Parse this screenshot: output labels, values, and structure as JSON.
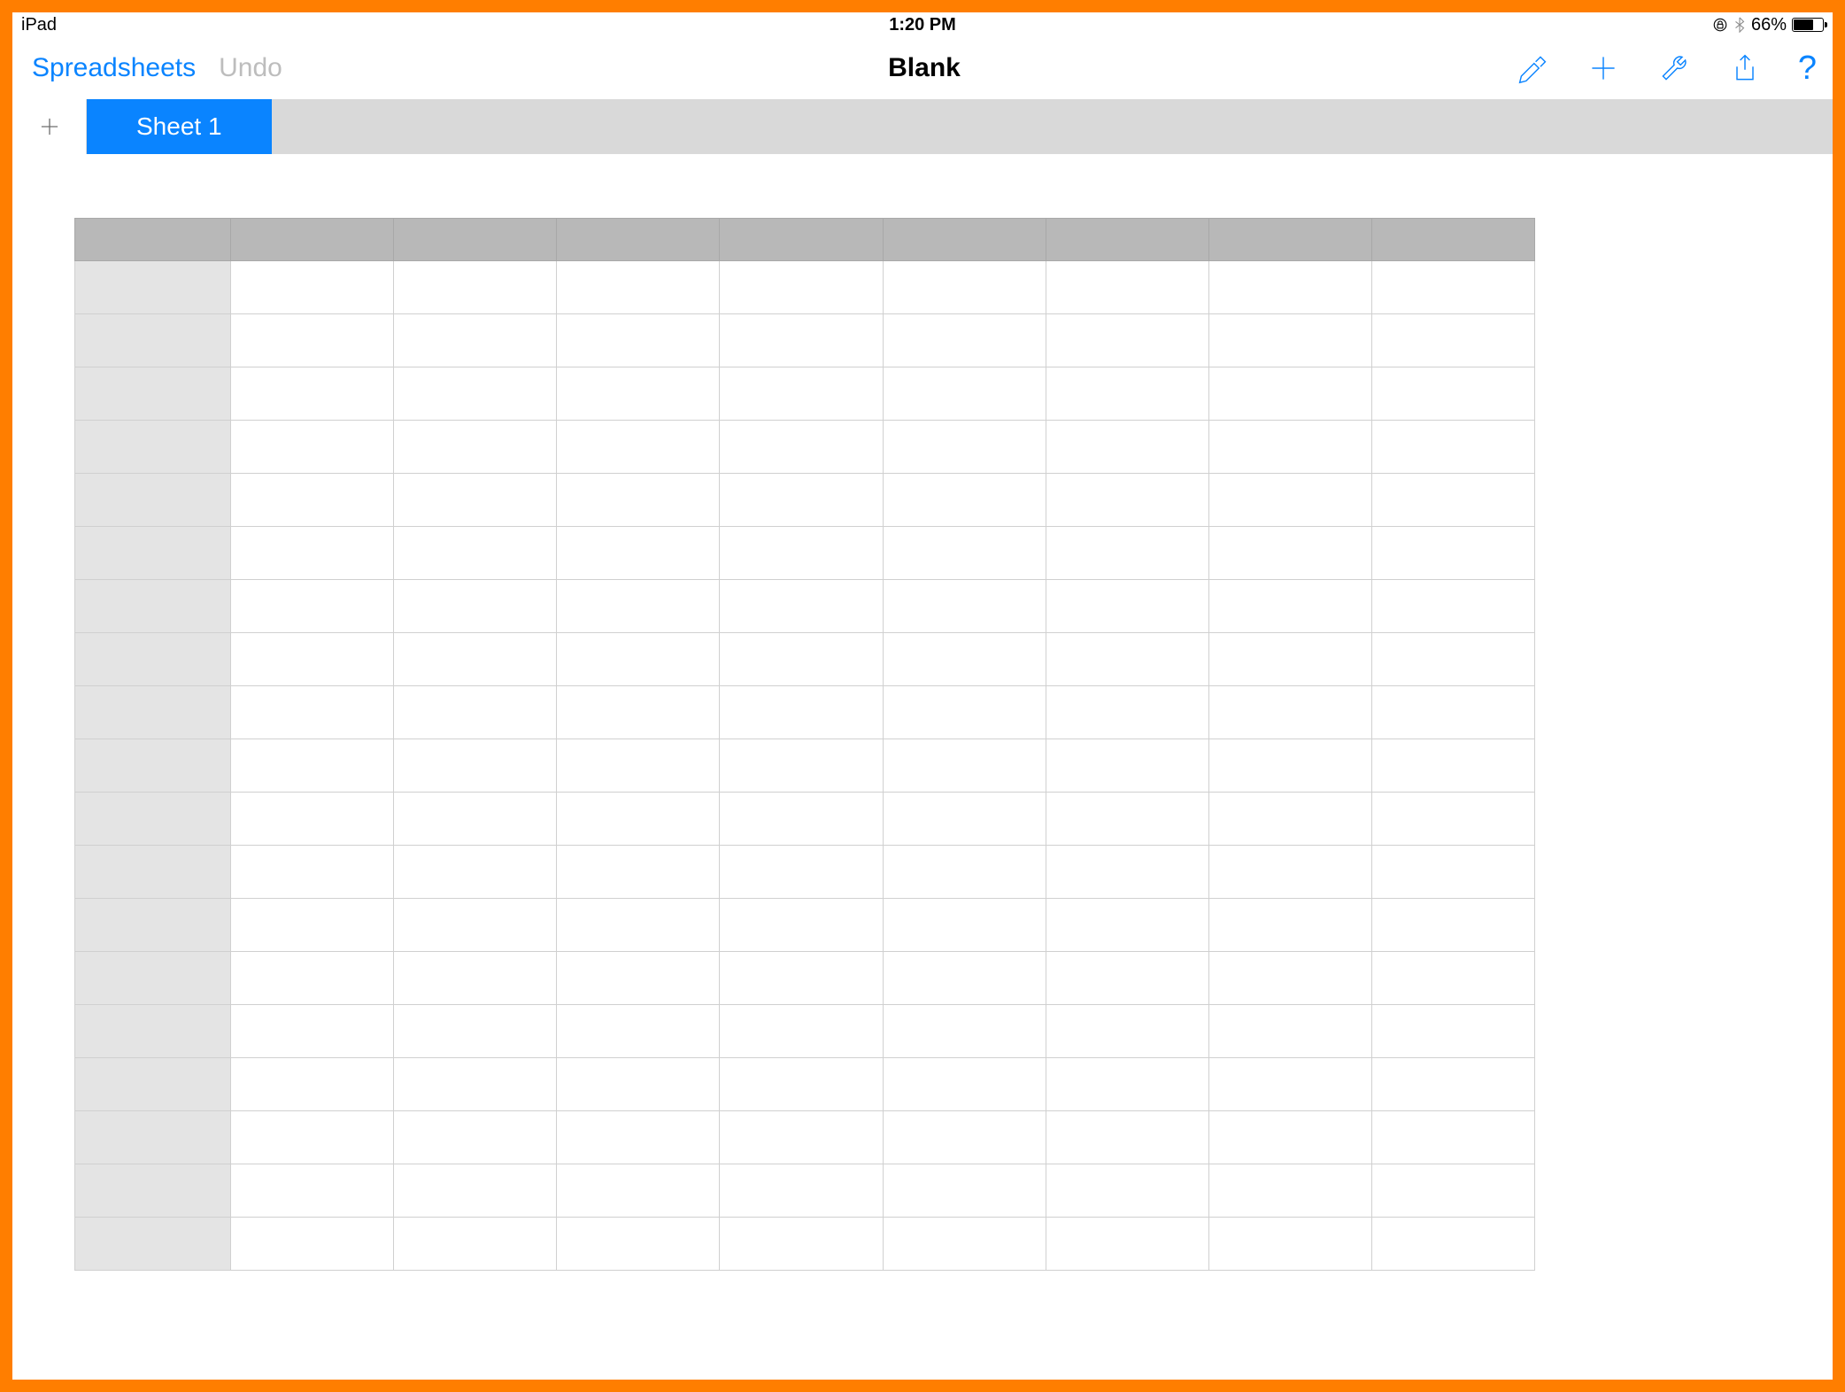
{
  "status": {
    "device": "iPad",
    "time": "1:20 PM",
    "battery_pct": "66%"
  },
  "toolbar": {
    "back_label": "Spreadsheets",
    "undo_label": "Undo",
    "title": "Blank"
  },
  "tabs": {
    "active_label": "Sheet 1"
  },
  "grid": {
    "columns": 8,
    "rows": 19
  },
  "colors": {
    "accent": "#0a84ff",
    "frame": "#ff7e00",
    "tabbar": "#d9d9d9",
    "header_cell": "#b8b8b8",
    "row_header": "#e4e4e4"
  }
}
